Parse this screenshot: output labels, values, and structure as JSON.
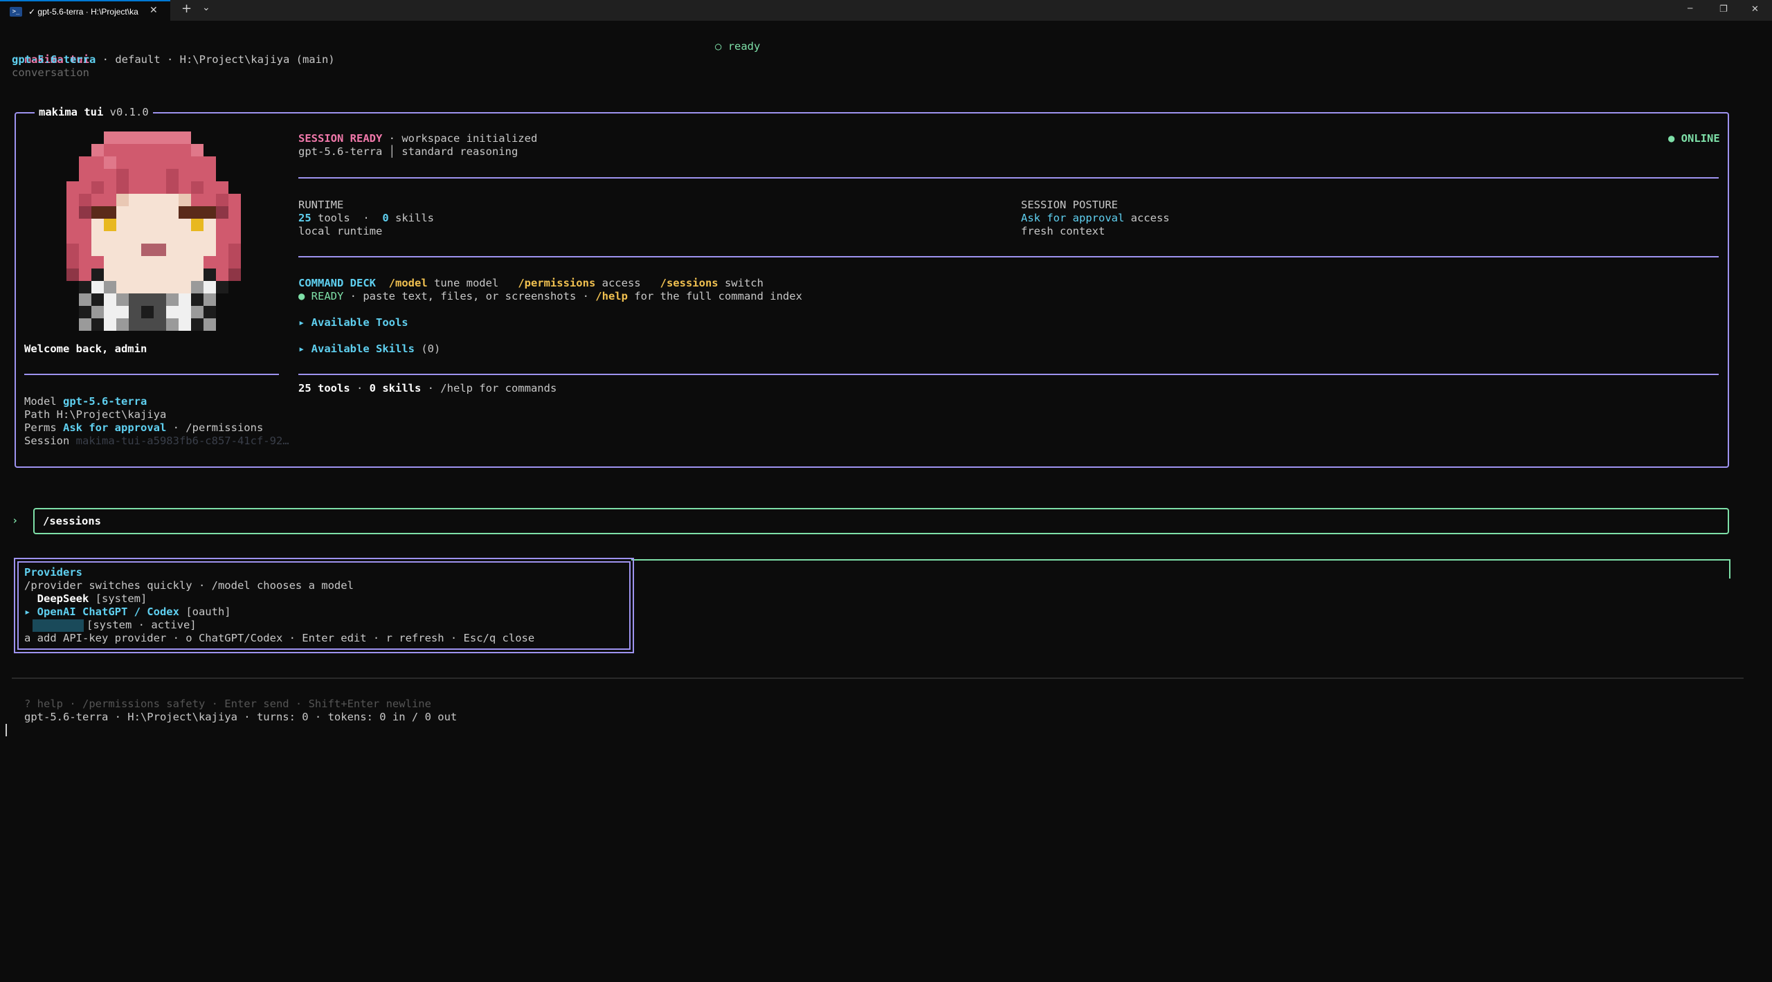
{
  "window": {
    "tab_title": "✓ gpt-5.6-terra · H:\\Project\\ka",
    "tab_icon": "powershell-icon",
    "new_tab": "+",
    "dropdown": "⌄",
    "minimize": "─",
    "maximize": "❐",
    "close": "✕"
  },
  "header": {
    "app_name": "makima tui",
    "model": "gpt-5.6-terra",
    "details": " · default · H:\\Project\\kajiya (main)",
    "view": "conversation",
    "status_dot": "○",
    "status": "ready"
  },
  "banner": {
    "title_name": "makima tui",
    "title_version": "v0.1.0",
    "welcome": "Welcome back, admin",
    "info": {
      "model_label": "Model ",
      "model_value": "gpt-5.6-terra",
      "path_label": "Path ",
      "path_value": "H:\\Project\\kajiya",
      "perms_label": "Perms ",
      "perms_value": "Ask for approval",
      "perms_suffix": " · /permissions",
      "session_label": "Session ",
      "session_value": "makima-tui-a5983fb6-c857-41cf-92…"
    },
    "session_ready": "SESSION READY",
    "session_ready_suffix": " · workspace initialized",
    "model_line": "gpt-5.6-terra │ standard reasoning",
    "online": "● ONLINE",
    "runtime": {
      "heading": "RUNTIME",
      "tools_count": "25",
      "tools_label": " tools  ·  ",
      "skills_count": "0",
      "skills_label": " skills",
      "runtime_kind": "local runtime"
    },
    "posture": {
      "heading": "SESSION POSTURE",
      "approval": "Ask for approval",
      "approval_suffix": " access",
      "context": "fresh context"
    },
    "command_deck": {
      "label": "COMMAND DECK",
      "cmd1": "/model",
      "cmd1_desc": " tune model",
      "cmd2": "/permissions",
      "cmd2_desc": " access",
      "cmd3": "/sessions",
      "cmd3_desc": " switch",
      "ready_dot": "●",
      "ready": " READY",
      "ready_desc": " · paste text, files, or screenshots · ",
      "help_cmd": "/help",
      "help_desc": " for the full command index"
    },
    "available_tools": "▸ Available Tools",
    "available_skills": "▸ Available Skills",
    "available_skills_count": " (0)",
    "summary": {
      "tools": "25 tools",
      "sep": " · ",
      "skills": "0 skills",
      "help": " · /help for commands"
    }
  },
  "prompt": {
    "caret": "›",
    "value": "/sessions"
  },
  "providers": {
    "title": "Providers",
    "hint": "/provider switches quickly · /model chooses a model",
    "items": [
      {
        "name": "DeepSeek",
        "tag": " [system]"
      },
      {
        "name": "OpenAI ChatGPT / Codex",
        "tag": " [oauth]",
        "selected_marker": "▸ "
      },
      {
        "name": "",
        "tag": "[system · active]"
      }
    ],
    "keys": "a add API-key provider · o ChatGPT/Codex · Enter edit · r refresh · Esc/q close"
  },
  "footer": {
    "hints": "? help · /permissions safety · Enter send · Shift+Enter newline",
    "status": "gpt-5.6-terra · H:\\Project\\kajiya · turns: 0 · tokens: 0 in / 0 out"
  }
}
